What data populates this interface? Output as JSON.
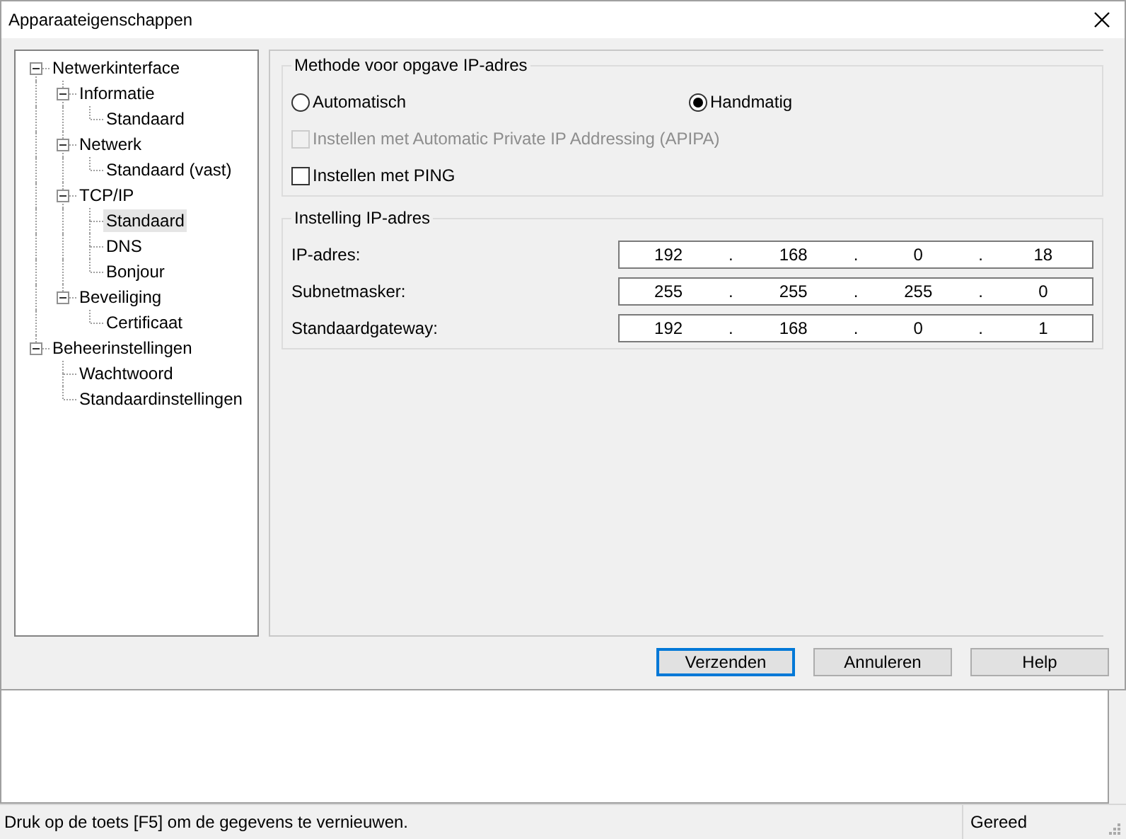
{
  "window": {
    "title": "Apparaateigenschappen"
  },
  "tree": [
    {
      "label": "Netwerkinterface",
      "selected": false,
      "expanded": true,
      "children": [
        {
          "label": "Informatie",
          "selected": false,
          "expanded": true,
          "children": [
            {
              "label": "Standaard",
              "selected": false
            }
          ]
        },
        {
          "label": "Netwerk",
          "selected": false,
          "expanded": true,
          "children": [
            {
              "label": "Standaard (vast)",
              "selected": false
            }
          ]
        },
        {
          "label": "TCP/IP",
          "selected": false,
          "expanded": true,
          "children": [
            {
              "label": "Standaard",
              "selected": true
            },
            {
              "label": "DNS",
              "selected": false
            },
            {
              "label": "Bonjour",
              "selected": false
            }
          ]
        },
        {
          "label": "Beveiliging",
          "selected": false,
          "expanded": true,
          "children": [
            {
              "label": "Certificaat",
              "selected": false
            }
          ]
        }
      ]
    },
    {
      "label": "Beheerinstellingen",
      "selected": false,
      "expanded": true,
      "children": [
        {
          "label": "Wachtwoord",
          "selected": false
        },
        {
          "label": "Standaardinstellingen",
          "selected": false
        }
      ]
    }
  ],
  "method_group": {
    "title": "Methode voor opgave IP-adres",
    "radios": [
      {
        "label": "Automatisch",
        "selected": false
      },
      {
        "label": "Handmatig",
        "selected": true
      }
    ],
    "checkboxes": [
      {
        "label": "Instellen met Automatic Private IP Addressing (APIPA)",
        "checked": false,
        "disabled": true
      },
      {
        "label": "Instellen met PING",
        "checked": false,
        "disabled": false
      }
    ]
  },
  "ip_group": {
    "title": "Instelling IP-adres",
    "rows": [
      {
        "label": "IP-adres:",
        "parts": [
          {
            "kind": "octet",
            "text": "192"
          },
          {
            "kind": "dot",
            "text": "."
          },
          {
            "kind": "octet",
            "text": "168"
          },
          {
            "kind": "dot",
            "text": "."
          },
          {
            "kind": "octet",
            "text": "0"
          },
          {
            "kind": "dot",
            "text": "."
          },
          {
            "kind": "octet",
            "text": "18"
          }
        ]
      },
      {
        "label": "Subnetmasker:",
        "parts": [
          {
            "kind": "octet",
            "text": "255"
          },
          {
            "kind": "dot",
            "text": "."
          },
          {
            "kind": "octet",
            "text": "255"
          },
          {
            "kind": "dot",
            "text": "."
          },
          {
            "kind": "octet",
            "text": "255"
          },
          {
            "kind": "dot",
            "text": "."
          },
          {
            "kind": "octet",
            "text": "0"
          }
        ]
      },
      {
        "label": "Standaardgateway:",
        "parts": [
          {
            "kind": "octet",
            "text": "192"
          },
          {
            "kind": "dot",
            "text": "."
          },
          {
            "kind": "octet",
            "text": "168"
          },
          {
            "kind": "dot",
            "text": "."
          },
          {
            "kind": "octet",
            "text": "0"
          },
          {
            "kind": "dot",
            "text": "."
          },
          {
            "kind": "octet",
            "text": "1"
          }
        ]
      }
    ]
  },
  "buttons": [
    {
      "label": "Verzenden",
      "focused": true
    },
    {
      "label": "Annuleren",
      "focused": false
    },
    {
      "label": "Help",
      "focused": false
    }
  ],
  "status_bar": {
    "message": "Druk op de toets [F5] om de gegevens te vernieuwen.",
    "state": "Gereed"
  }
}
